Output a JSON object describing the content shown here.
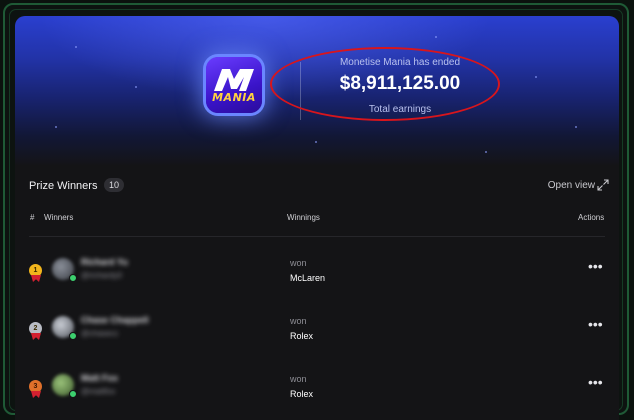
{
  "banner": {
    "logo_icon": "mania-logo-icon",
    "logo_word": "MANIA",
    "status_text": "Monetise Mania has ended",
    "amount": "$8,911,125.00",
    "amount_label": "Total earnings",
    "highlight_color": "#d8151c"
  },
  "winners": {
    "title": "Prize Winners",
    "count": "10",
    "open_view_label": "Open view",
    "columns": {
      "number": "#",
      "winners": "Winners",
      "winnings": "Winnings",
      "actions": "Actions"
    },
    "rows": [
      {
        "rank": "1",
        "medal_color": "#f2b51c",
        "name": "Richard Yu",
        "handle": "@richardy0",
        "won_label": "won",
        "prize": "McLaren",
        "actions_icon": "more-horizontal-icon"
      },
      {
        "rank": "2",
        "medal_color": "#b9bcc4",
        "name": "Chase Chappell",
        "handle": "@chasecc",
        "won_label": "won",
        "prize": "Rolex",
        "actions_icon": "more-horizontal-icon"
      },
      {
        "rank": "3",
        "medal_color": "#e0702a",
        "name": "Matt Fox",
        "handle": "@mattfox",
        "won_label": "won",
        "prize": "Rolex",
        "actions_icon": "more-horizontal-icon"
      }
    ]
  }
}
